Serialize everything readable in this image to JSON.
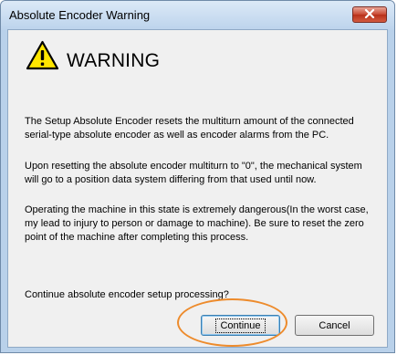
{
  "window": {
    "title": "Absolute Encoder Warning",
    "close_icon": "close-icon"
  },
  "dialog": {
    "warning_icon": "warning-triangle-icon",
    "heading": "WARNING",
    "paragraphs": [
      "The Setup Absolute Encoder resets the multiturn amount of the connected serial-type absolute encoder as well as encoder alarms from the PC.",
      "Upon resetting the absolute encoder multiturn to \"0\", the mechanical system will go to a position data system differing from that used until now.",
      "Operating the machine in this state is extremely dangerous(In the worst case, my lead to injury to person or damage to machine). Be sure to reset the zero point of the machine after completing this process."
    ],
    "question": "Continue absolute encoder setup processing?"
  },
  "buttons": {
    "continue_label": "Continue",
    "cancel_label": "Cancel"
  },
  "colors": {
    "highlight": "#ed8b2c",
    "warning_yellow": "#ffe600",
    "close_red": "#c8462f"
  }
}
